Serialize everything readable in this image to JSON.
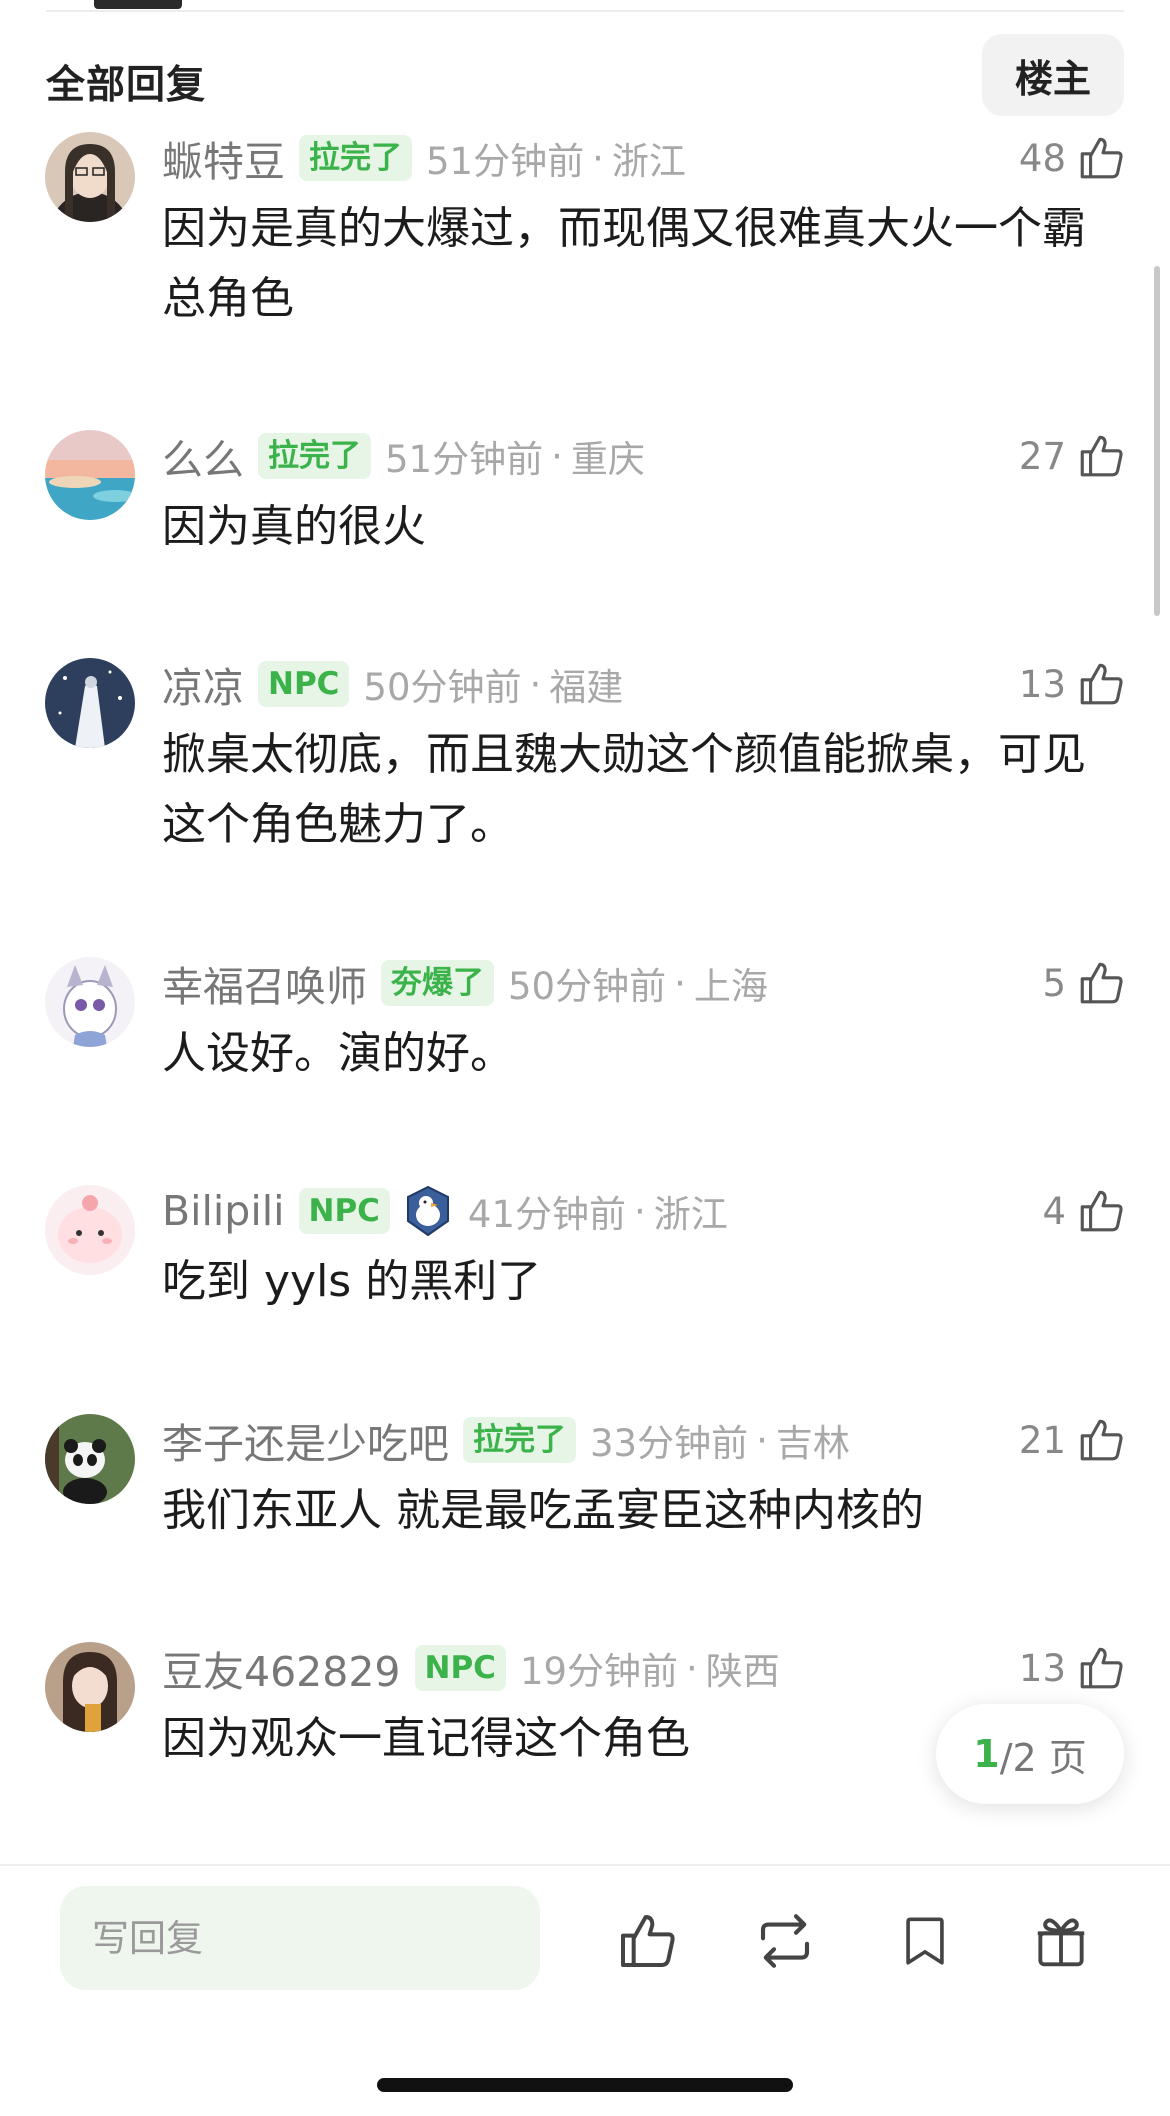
{
  "header": {
    "title": "全部回复",
    "op_button": "楼主"
  },
  "comments": [
    {
      "nickname": "蝂特豆",
      "badge": "拉完了",
      "time": "51分钟前",
      "location": "浙江",
      "likes": "48",
      "text": "因为是真的大爆过，而现偶又很难真大火一个霸总角色"
    },
    {
      "nickname": "么么",
      "badge": "拉完了",
      "time": "51分钟前",
      "location": "重庆",
      "likes": "27",
      "text": "因为真的很火"
    },
    {
      "nickname": "凉凉",
      "badge": "NPC",
      "time": "50分钟前",
      "location": "福建",
      "likes": "13",
      "text": "掀桌太彻底，而且魏大勋这个颜值能掀桌，可见这个角色魅力了。"
    },
    {
      "nickname": "幸福召唤师",
      "badge": "夯爆了",
      "time": "50分钟前",
      "location": "上海",
      "likes": "5",
      "text": "人设好。演的好。"
    },
    {
      "nickname": "Bilipili",
      "badge": "NPC",
      "time": "41分钟前",
      "location": "浙江",
      "likes": "4",
      "text": "吃到 yyls 的黑利了"
    },
    {
      "nickname": "李子还是少吃吧",
      "badge": "拉完了",
      "time": "33分钟前",
      "location": "吉林",
      "likes": "21",
      "text": "我们东亚人 就是最吃孟宴臣这种内核的"
    },
    {
      "nickname": "豆友462829",
      "badge": "NPC",
      "time": "19分钟前",
      "location": "陕西",
      "likes": "13",
      "text": "因为观众一直记得这个角色"
    }
  ],
  "pagination": {
    "current": "1",
    "total_text": "/2 页"
  },
  "bottom_bar": {
    "reply_placeholder": "写回复"
  },
  "colors": {
    "accent_green": "#3bb34a",
    "badge_bg": "#e6f5e6"
  }
}
